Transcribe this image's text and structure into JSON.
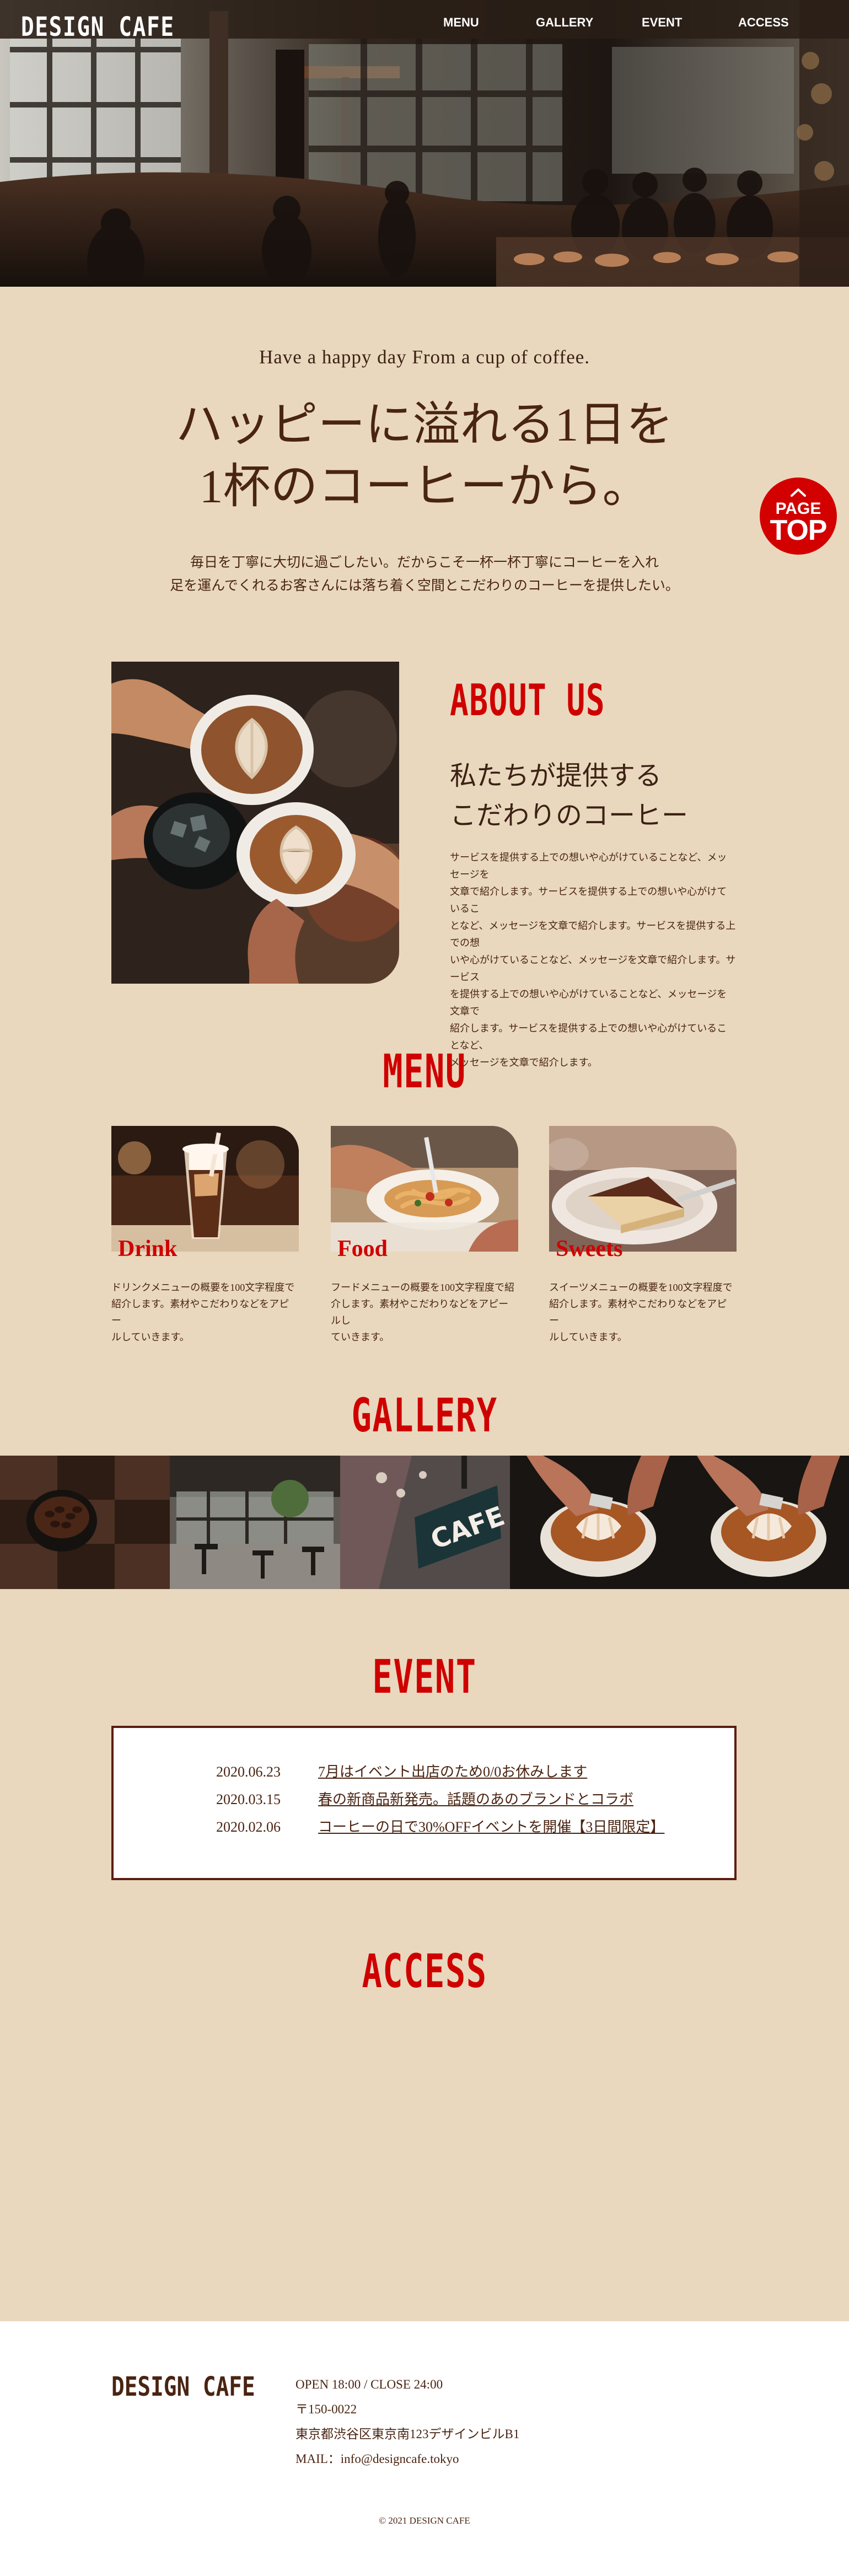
{
  "site": {
    "logo": "DESIGN CAFE"
  },
  "nav": {
    "items": [
      {
        "label": "MENU"
      },
      {
        "label": "GALLERY"
      },
      {
        "label": "EVENT"
      },
      {
        "label": "ACCESS"
      }
    ]
  },
  "page_top": {
    "line1": "PAGE",
    "line2": "TOP"
  },
  "intro": {
    "english": "Have a happy day From a cup of coffee.",
    "title_line1": "ハッピーに溢れる1日を",
    "title_line2": "1杯のコーヒーから。",
    "body_line1": "毎日を丁寧に大切に過ごしたい。だからこそ一杯一杯丁寧にコーヒーを入れ",
    "body_line2": "足を運んでくれるお客さんには落ち着く空間とこだわりのコーヒーを提供したい。"
  },
  "about": {
    "heading": "ABOUT US",
    "subtitle_line1": "私たちが提供する",
    "subtitle_line2": "こだわりのコーヒー",
    "body_lines": [
      "サービスを提供する上での想いや心がけていることなど、メッセージを",
      "文章で紹介します。サービスを提供する上での想いや心がけているこ",
      "となど、メッセージを文章で紹介します。サービスを提供する上での想",
      "いや心がけていることなど、メッセージを文章で紹介します。サービス",
      "を提供する上での想いや心がけていることなど、メッセージを文章で",
      "紹介します。サービスを提供する上での想いや心がけていることなど、",
      "メッセージを文章で紹介します。"
    ]
  },
  "menu": {
    "heading": "MENU",
    "cards": [
      {
        "title": "Drink",
        "desc_line1": "ドリンクメニューの概要を100文字程度で",
        "desc_line2": "紹介します。素材やこだわりなどをアピー",
        "desc_line3": "ルしていきます。"
      },
      {
        "title": "Food",
        "desc_line1": "フードメニューの概要を100文字程度で紹",
        "desc_line2": "介します。素材やこだわりなどをアピールし",
        "desc_line3": "ていきます。"
      },
      {
        "title": "Sweets",
        "desc_line1": "スイーツメニューの概要を100文字程度で",
        "desc_line2": "紹介します。素材やこだわりなどをアピー",
        "desc_line3": "ルしていきます。"
      }
    ]
  },
  "gallery": {
    "heading": "GALLERY",
    "sign_text": "CAFE"
  },
  "event": {
    "heading": "EVENT",
    "items": [
      {
        "date": "2020.06.23",
        "title": "7月はイベント出店のため0/0お休みします"
      },
      {
        "date": "2020.03.15",
        "title": "春の新商品新発売。話題のあのブランドとコラボ"
      },
      {
        "date": "2020.02.06",
        "title": "コーヒーの日で30%OFFイベントを開催【3日間限定】"
      }
    ]
  },
  "access": {
    "heading": "ACCESS"
  },
  "footer": {
    "logo": "DESIGN CAFE",
    "hours": "OPEN 18:00 / CLOSE 24:00",
    "postal": "〒150-0022",
    "address": "東京都渋谷区東京南123デザインビルB1",
    "mail": "MAIL：info@designcafe.tokyo",
    "copyright": "© 2021 DESIGN CAFE"
  },
  "colors": {
    "background": "#e9d8be",
    "accent_red": "#d30000",
    "text_brown": "#4a2412",
    "footer_bg": "#ffffff"
  }
}
